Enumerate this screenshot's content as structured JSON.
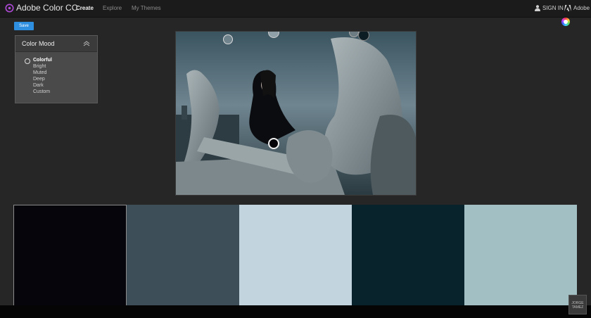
{
  "app": {
    "title": "Adobe Color CC"
  },
  "nav": {
    "tabs": [
      {
        "label": "Create",
        "active": true
      },
      {
        "label": "Explore",
        "active": false
      },
      {
        "label": "My Themes",
        "active": false
      }
    ]
  },
  "header_right": {
    "sign_in": "SIGN IN",
    "brand": "Adobe"
  },
  "toolbar": {
    "save_label": "Save"
  },
  "color_mood": {
    "title": "Color Mood",
    "options": [
      "Colorful",
      "Bright",
      "Muted",
      "Deep",
      "Dark",
      "Custom"
    ],
    "selected": "Colorful"
  },
  "swatches": [
    {
      "color": "#06050b",
      "selected": true
    },
    {
      "color": "#3d4e58",
      "selected": false
    },
    {
      "color": "#c2d4dd",
      "selected": false
    },
    {
      "color": "#09232c",
      "selected": false
    },
    {
      "color": "#a2bfc4",
      "selected": false
    }
  ],
  "watermark": {
    "line1": "JORGE",
    "line2": "TAMEZ"
  },
  "colors": {
    "accent": "#2e8ee0",
    "background": "#262626",
    "topbar": "#1b1b1b"
  }
}
